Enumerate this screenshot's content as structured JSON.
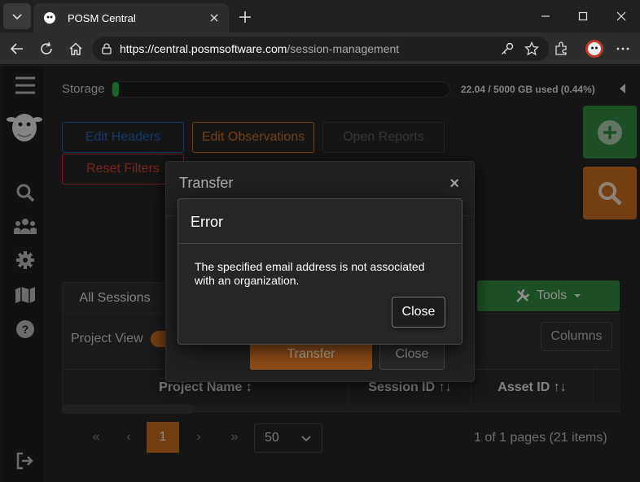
{
  "browser": {
    "tab_title": "POSM Central",
    "url_domain": "https://central.posmsoftware.com",
    "url_path": "/session-management"
  },
  "storage": {
    "label": "Storage",
    "usage_text": "22.04 / 5000 GB used (0.44%)",
    "percent_used": 0.44
  },
  "toolbar": {
    "edit_headers": "Edit Headers",
    "edit_observations": "Edit Observations",
    "open_reports": "Open Reports",
    "reset_filters": "Reset Filters"
  },
  "panel": {
    "tab_label": "All Sessions",
    "project_view_label": "Project View",
    "columns_label": "Columns",
    "tools_label": "Tools",
    "headers": [
      "Project Name ↕",
      "Session ID ↑↓",
      "Asset ID ↑↓"
    ]
  },
  "pager": {
    "first": "«",
    "prev": "‹",
    "current": "1",
    "next": "›",
    "last": "»",
    "page_size": "50",
    "info": "1 of 1 pages (21 items)"
  },
  "transfer_modal": {
    "title": "Transfer",
    "close_x": "×",
    "submit_label": "Transfer",
    "close_label": "Close"
  },
  "error_modal": {
    "title": "Error",
    "message": "The specified email address is not associated with an organization.",
    "close_label": "Close"
  },
  "colors": {
    "accent_orange": "#b6621f",
    "accent_green": "#2e7d3a",
    "edit_headers_blue": "#1e5aa8"
  },
  "icons": [
    "tab-menu-icon",
    "favicon-icon",
    "new-tab-icon",
    "minimize-icon",
    "maximize-icon",
    "window-close-icon",
    "back-icon",
    "refresh-icon",
    "home-icon",
    "lock-icon",
    "key-icon",
    "star-icon",
    "extensions-icon",
    "profile-icon",
    "more-icon",
    "hamburger-icon",
    "logo-icon",
    "search-icon",
    "users-icon",
    "settings-icon",
    "map-icon",
    "help-icon",
    "logout-icon",
    "plus-icon",
    "search-fab-icon",
    "wrench-icon"
  ]
}
